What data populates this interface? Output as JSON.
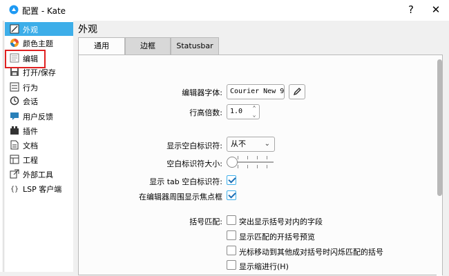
{
  "window": {
    "title": "配置 - Kate",
    "help_label": "?",
    "close_label": "✕"
  },
  "sidebar": {
    "items": [
      {
        "label": "外观",
        "icon": "appearance-icon"
      },
      {
        "label": "颜色主题",
        "icon": "color-theme-icon"
      },
      {
        "label": "编辑",
        "icon": "edit-icon"
      },
      {
        "label": "打开/保存",
        "icon": "open-save-icon"
      },
      {
        "label": "行为",
        "icon": "behavior-icon"
      },
      {
        "label": "会话",
        "icon": "session-icon"
      },
      {
        "label": "用户反馈",
        "icon": "feedback-icon"
      },
      {
        "label": "插件",
        "icon": "plugin-icon"
      },
      {
        "label": "文档",
        "icon": "document-icon"
      },
      {
        "label": "工程",
        "icon": "project-icon"
      },
      {
        "label": "外部工具",
        "icon": "external-tools-icon"
      },
      {
        "label": "LSP 客户端",
        "icon": "lsp-icon"
      }
    ],
    "selected_index": 0
  },
  "content": {
    "page_title": "外观",
    "tabs": [
      {
        "label": "通用",
        "active": true
      },
      {
        "label": "边框",
        "active": false
      },
      {
        "label": "Statusbar",
        "active": false
      }
    ],
    "font": {
      "label": "编辑器字体:",
      "value": "Courier New 9"
    },
    "line_height": {
      "label": "行高倍数:",
      "value": "1.0"
    },
    "show_whitespace": {
      "label": "显示空白标识符:",
      "value": "从不"
    },
    "whitespace_size": {
      "label": "空白标识符大小:",
      "level": 0
    },
    "show_tab": {
      "label": "显示 tab 空白标识符:",
      "checked": true
    },
    "focus_frame": {
      "label": "在编辑器周围显示焦点框",
      "checked": true
    },
    "bracket": {
      "label": "括号匹配:",
      "options": [
        {
          "label": "突出显示括号对内的字段",
          "checked": false
        },
        {
          "label": "显示匹配的开括号预览",
          "checked": false
        },
        {
          "label": "光标移动到其他成对括号时闪烁匹配的括号",
          "checked": false
        },
        {
          "label": "显示缩进行(H)",
          "checked": false
        }
      ]
    }
  },
  "colors": {
    "accent": "#3daee9",
    "highlight_box": "#e02020"
  }
}
